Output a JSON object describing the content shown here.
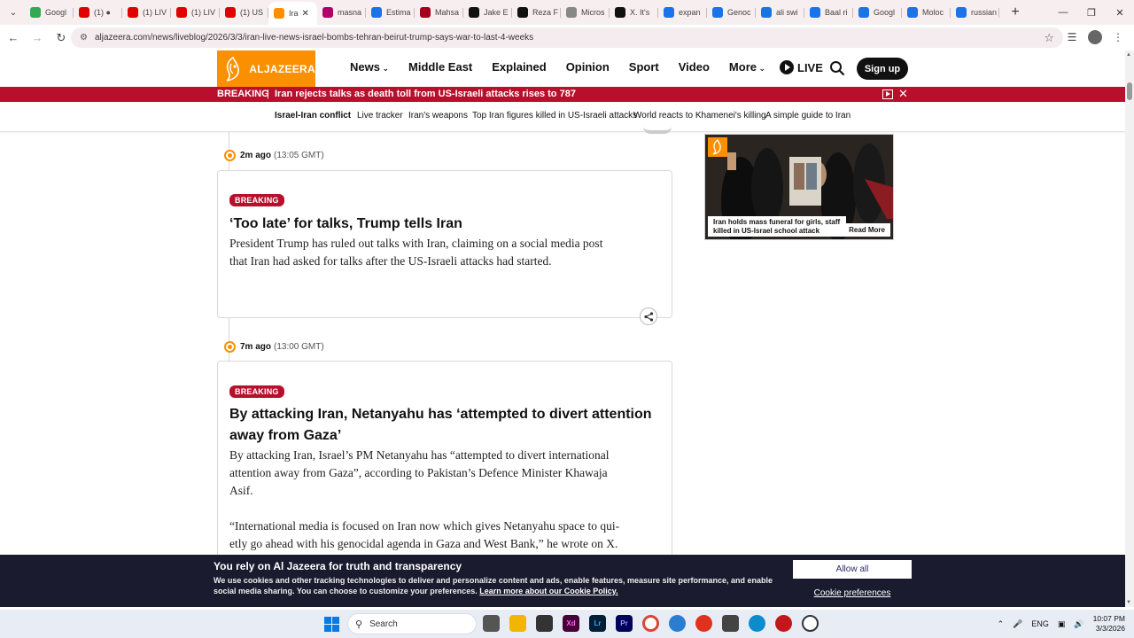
{
  "browser": {
    "tabs": [
      {
        "label": "Googl",
        "color": "#34a853",
        "active": false
      },
      {
        "label": "(1) ●",
        "color": "#e00000",
        "active": false
      },
      {
        "label": "(1) LIV",
        "color": "#e00000",
        "active": false
      },
      {
        "label": "(1) LIV",
        "color": "#e00000",
        "active": false
      },
      {
        "label": "(1) US",
        "color": "#e00000",
        "active": false
      },
      {
        "label": "Ira",
        "color": "#fa9000",
        "active": true
      },
      {
        "label": "masna",
        "color": "#b0006b",
        "active": false
      },
      {
        "label": "Estima",
        "color": "#1a73e8",
        "active": false
      },
      {
        "label": "Mahsa",
        "color": "#a3001b",
        "active": false
      },
      {
        "label": "Jake E",
        "color": "#111111",
        "active": false
      },
      {
        "label": "Reza F",
        "color": "#111111",
        "active": false
      },
      {
        "label": "Micros",
        "color": "#888888",
        "active": false
      },
      {
        "label": "X. It's",
        "color": "#111111",
        "active": false
      },
      {
        "label": "expan",
        "color": "#1a73e8",
        "active": false
      },
      {
        "label": "Genoc",
        "color": "#1a73e8",
        "active": false
      },
      {
        "label": "ali swi",
        "color": "#1a73e8",
        "active": false
      },
      {
        "label": "Baal ri",
        "color": "#1a73e8",
        "active": false
      },
      {
        "label": "Googl",
        "color": "#1a73e8",
        "active": false
      },
      {
        "label": "Moloc",
        "color": "#1a73e8",
        "active": false
      },
      {
        "label": "russian",
        "color": "#1a73e8",
        "active": false
      }
    ],
    "url": "aljazeera.com/news/liveblog/2026/3/3/iran-live-news-israel-bombs-tehran-beirut-trump-says-war-to-last-4-weeks"
  },
  "site": {
    "logo_text": "ALJAZEERA",
    "nav": [
      {
        "label": "News",
        "has_dropdown": true
      },
      {
        "label": "Middle East",
        "has_dropdown": false
      },
      {
        "label": "Explained",
        "has_dropdown": false
      },
      {
        "label": "Opinion",
        "has_dropdown": false
      },
      {
        "label": "Sport",
        "has_dropdown": false
      },
      {
        "label": "Video",
        "has_dropdown": false
      },
      {
        "label": "More",
        "has_dropdown": true
      }
    ],
    "live_label": "LIVE",
    "signup_label": "Sign up",
    "accent": "#fa9000",
    "breaking_color": "#b8102c"
  },
  "breaking_bar": {
    "tag": "BREAKING",
    "separator": "|",
    "text": "Iran rejects talks as death toll from US-Israeli attacks rises to 787"
  },
  "subnav": [
    {
      "label": "Israel-Iran conflict",
      "bold": true
    },
    {
      "label": "Live tracker",
      "bold": false
    },
    {
      "label": "Iran's weapons",
      "bold": false
    },
    {
      "label": "Top Iran figures killed in US-Israeli attacks",
      "bold": false
    },
    {
      "label": "World reacts to Khamenei's killing",
      "bold": false
    },
    {
      "label": "A simple guide to Iran",
      "bold": false
    }
  ],
  "posts": [
    {
      "time_relative": "2m ago",
      "time_absolute": "(13:05 GMT)",
      "badge": "BREAKING",
      "title_lines": [
        "‘Too late’ for talks, Trump tells Iran"
      ],
      "body_lines": [
        "President Trump has ruled out talks with Iran, claiming on a social media post",
        "that Iran had asked for talks after the US-Israeli attacks had started."
      ]
    },
    {
      "time_relative": "7m ago",
      "time_absolute": "(13:00 GMT)",
      "badge": "BREAKING",
      "title_lines": [
        "By attacking Iran, Netanyahu has ‘attempted to divert attention",
        "away from Gaza’"
      ],
      "body_lines": [
        "By attacking Iran, Israel’s PM Netanyahu has “attempted to divert international",
        "attention away from Gaza”, according to Pakistan’s Defence Minister Khawaja",
        "Asif.",
        "",
        "“International media is focused on Iran now which gives Netanyahu space to qui-",
        "etly go ahead with his genocidal agenda in Gaza and West Bank,” he wrote on X."
      ]
    }
  ],
  "promo": {
    "caption": "Iran holds mass funeral for girls, staff killed in US-Israel school attack",
    "read_more": "Read More"
  },
  "cookie": {
    "title": "You rely on Al Jazeera for truth and transparency",
    "text": "We use cookies and other tracking technologies to deliver and personalize content and ads, enable features, measure site performance, and enable social media sharing. You can choose to customize your preferences.",
    "link": "Learn more about our Cookie Policy.",
    "allow": "Allow all",
    "prefs": "Cookie preferences"
  },
  "taskbar": {
    "search": "Search",
    "lang": "ENG",
    "time": "10:07 PM",
    "date": "3/3/2026"
  }
}
